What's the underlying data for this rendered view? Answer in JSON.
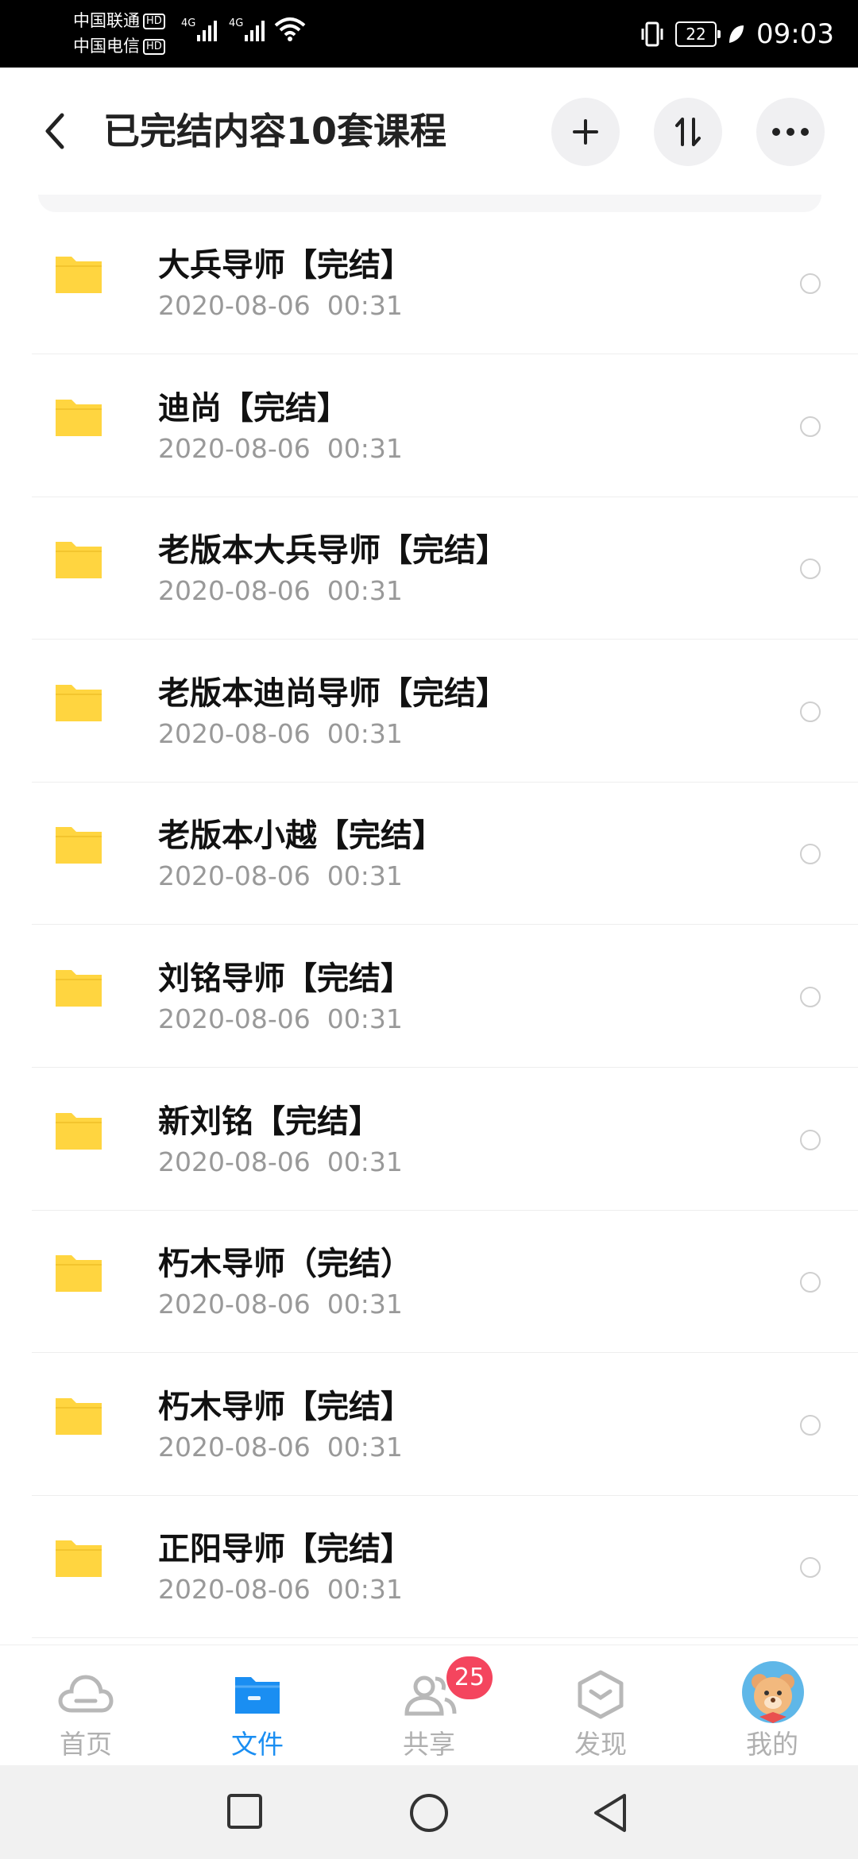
{
  "status_bar": {
    "carrier1": "中国联通",
    "carrier2": "中国电信",
    "hd": "HD",
    "net1": "4G",
    "net2": "4G",
    "battery": "22",
    "time": "09:03"
  },
  "header": {
    "title": "已完结内容10套课程",
    "icons": [
      "back-icon",
      "plus-icon",
      "sort-icon",
      "more-icon"
    ]
  },
  "files": [
    {
      "name": "大兵导师【完结】",
      "date": "2020-08-06  00:31"
    },
    {
      "name": "迪尚【完结】",
      "date": "2020-08-06  00:31"
    },
    {
      "name": "老版本大兵导师【完结】",
      "date": "2020-08-06  00:31"
    },
    {
      "name": "老版本迪尚导师【完结】",
      "date": "2020-08-06  00:31"
    },
    {
      "name": "老版本小越【完结】",
      "date": "2020-08-06  00:31"
    },
    {
      "name": "刘铭导师【完结】",
      "date": "2020-08-06  00:31"
    },
    {
      "name": "新刘铭【完结】",
      "date": "2020-08-06  00:31"
    },
    {
      "name": "朽木导师（完结）",
      "date": "2020-08-06  00:31"
    },
    {
      "name": "朽木导师【完结】",
      "date": "2020-08-06  00:31"
    },
    {
      "name": "正阳导师【完结】",
      "date": "2020-08-06  00:31"
    }
  ],
  "nav": {
    "tabs": [
      {
        "label": "首页",
        "icon": "cloud-icon"
      },
      {
        "label": "文件",
        "icon": "folder-icon",
        "active": true
      },
      {
        "label": "共享",
        "icon": "people-icon",
        "badge": "25"
      },
      {
        "label": "发现",
        "icon": "discover-icon"
      },
      {
        "label": "我的",
        "icon": "avatar"
      }
    ]
  },
  "colors": {
    "accent": "#1a8ef2",
    "folder": "#ffd540",
    "badge": "#f4455e"
  }
}
